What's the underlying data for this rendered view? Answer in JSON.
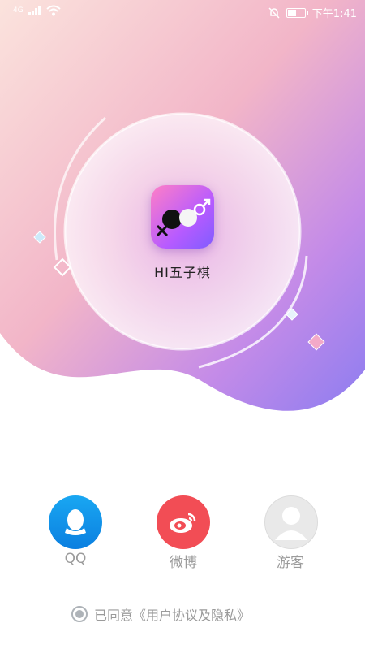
{
  "status_bar": {
    "network": "4G",
    "time": "下午1:41",
    "battery_level": 0.5
  },
  "app": {
    "name": "HI五子棋"
  },
  "login": {
    "qq_label": "QQ",
    "weibo_label": "微博",
    "guest_label": "游客"
  },
  "agreement": {
    "text": "已同意《用户协议及隐私》",
    "checked": true
  },
  "colors": {
    "qq": "#0b7fe0",
    "weibo": "#f24d55",
    "guest": "#e9e9e9",
    "accent_purple": "#b75bff"
  }
}
